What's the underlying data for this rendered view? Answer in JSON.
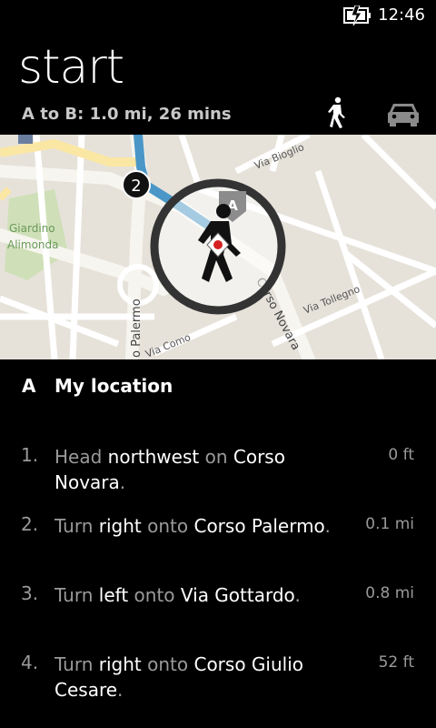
{
  "status": {
    "time": "12:46",
    "icon": "battery-charging-icon"
  },
  "header": {
    "title": "start",
    "summary": "A to B:  1.0 mi, 26 mins",
    "walk_icon": "walking-person-icon",
    "car_icon": "car-icon"
  },
  "map": {
    "labels": {
      "park": "Giardino",
      "park2": "Alimonda",
      "via_bioglio": "Via Bioglio",
      "corso_novara": "Corso Novara",
      "via_tollegno": "Via Tollegno",
      "corso_palermo": "o Palermo",
      "via_como": "Via Como"
    },
    "waypoint_number": "2",
    "pin_letter": "A"
  },
  "start": {
    "letter": "A",
    "label": "My location"
  },
  "steps": [
    {
      "num": "1.",
      "parts": [
        [
          "Head ",
          false
        ],
        [
          "northwest",
          true
        ],
        [
          " on ",
          false
        ],
        [
          "Corso Novara",
          true
        ],
        [
          ".",
          false
        ]
      ],
      "dist": "0 ft"
    },
    {
      "num": "2.",
      "parts": [
        [
          "Turn ",
          false
        ],
        [
          "right",
          true
        ],
        [
          " onto ",
          false
        ],
        [
          "Corso Palermo",
          true
        ],
        [
          ".",
          false
        ]
      ],
      "dist": "0.1 mi"
    },
    {
      "num": "3.",
      "parts": [
        [
          "Turn ",
          false
        ],
        [
          "left",
          true
        ],
        [
          " onto ",
          false
        ],
        [
          "Via Gottardo",
          true
        ],
        [
          ".",
          false
        ]
      ],
      "dist": "0.8 mi"
    },
    {
      "num": "4.",
      "parts": [
        [
          "Turn ",
          false
        ],
        [
          "right",
          true
        ],
        [
          " onto ",
          false
        ],
        [
          "Corso Giulio Cesare",
          true
        ],
        [
          ".",
          false
        ]
      ],
      "dist": "52 ft"
    }
  ]
}
